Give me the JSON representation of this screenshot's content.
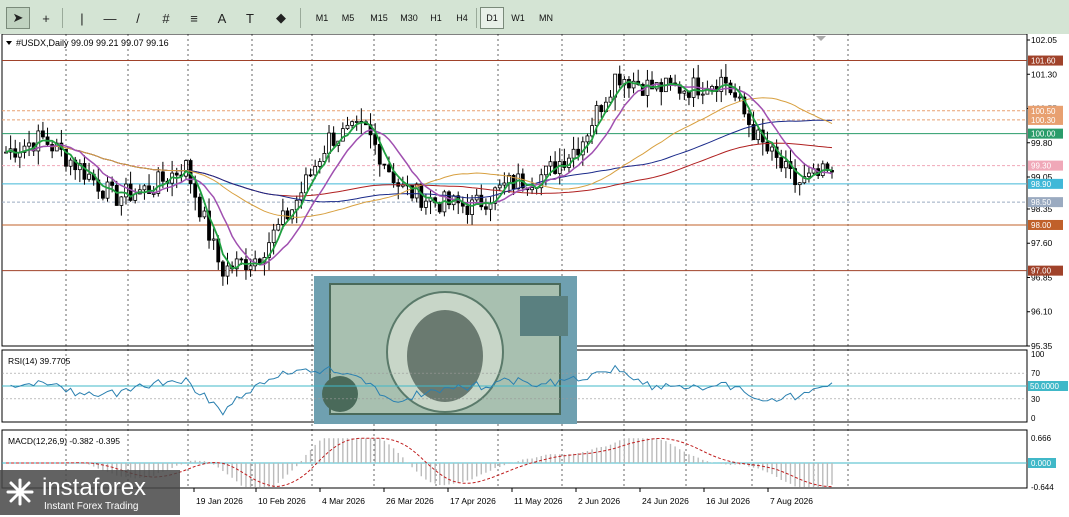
{
  "toolbar": {
    "timeframes": [
      "M1",
      "M5",
      "M15",
      "M30",
      "H1",
      "H4",
      "D1",
      "W1",
      "MN"
    ],
    "active_timeframe": "D1",
    "tools": [
      {
        "name": "cursor-icon",
        "glyph": "➤"
      },
      {
        "name": "crosshair-icon",
        "glyph": "+"
      },
      {
        "name": "vertical-line-icon",
        "glyph": "|"
      },
      {
        "name": "horizontal-line-icon",
        "glyph": "—"
      },
      {
        "name": "trendline-icon",
        "glyph": "/"
      },
      {
        "name": "channel-icon",
        "glyph": "#"
      },
      {
        "name": "fibonacci-icon",
        "glyph": "≡"
      },
      {
        "name": "text-icon",
        "glyph": "A"
      },
      {
        "name": "text-label-icon",
        "glyph": "T"
      },
      {
        "name": "shapes-icon",
        "glyph": "◆"
      }
    ]
  },
  "main_chart": {
    "header": "#USDX,Daily  99.09 99.21 99.07 99.16",
    "price_axis": [
      "102.05",
      "101.30",
      "100.55",
      "99.80",
      "99.05",
      "98.35",
      "97.60",
      "96.85",
      "96.10",
      "95.35"
    ],
    "level_lines": [
      {
        "label": "101.60",
        "color": "#a0422a"
      },
      {
        "label": "100.50",
        "color": "#e8a070"
      },
      {
        "label": "100.30",
        "color": "#e8a070"
      },
      {
        "label": "100.00",
        "color": "#2a9c6a"
      },
      {
        "label": "99.30",
        "color": "#f0a8b8"
      },
      {
        "label": "98.90",
        "color": "#40b8d8"
      },
      {
        "label": "98.50",
        "color": "#9aaac0"
      },
      {
        "label": "98.00",
        "color": "#c0602a"
      },
      {
        "label": "97.00",
        "color": "#a0422a"
      }
    ],
    "current_price": "99.16"
  },
  "chart_data": {
    "type": "line",
    "x": [
      "2025-12-10",
      "2025-12-20",
      "2025-12-31",
      "2026-01-10",
      "2026-01-19",
      "2026-01-28",
      "2026-02-10",
      "2026-02-20",
      "2026-03-04",
      "2026-03-15",
      "2026-03-26",
      "2026-04-05",
      "2026-04-17",
      "2026-04-28",
      "2026-05-11",
      "2026-05-22",
      "2026-06-02",
      "2026-06-13",
      "2026-06-24",
      "2026-07-05",
      "2026-07-16",
      "2026-07-27",
      "2026-08-07",
      "2026-08-18"
    ],
    "series": [
      {
        "name": "",
        "values": [
          99.6,
          99.9,
          99.3,
          98.6,
          98.8,
          99.3,
          97.0,
          97.3,
          98.4,
          99.9,
          100.1,
          98.8,
          98.5,
          98.4,
          98.9,
          99.1,
          99.8,
          101.3,
          101.0,
          101.0,
          101.2,
          99.8,
          98.9,
          99.16
        ]
      }
    ],
    "ylim": [
      95.35,
      102.05
    ]
  },
  "rsi": {
    "header": "RSI(14) 39.7705",
    "axis": [
      "100",
      "70",
      "50.0000",
      "30",
      "0"
    ]
  },
  "macd": {
    "header": "MACD(12,26,9) -0.382 -0.395",
    "axis": [
      "0.666",
      "0.000",
      "-0.644"
    ]
  },
  "date_axis": [
    "19 Jan 2026",
    "10 Feb 2026",
    "4 Mar 2026",
    "26 Mar 2026",
    "17 Apr 2026",
    "11 May 2026",
    "2 Jun 2026",
    "24 Jun 2026",
    "16 Jul 2026",
    "7 Aug 2026"
  ],
  "branding": {
    "logo": "instaforex",
    "tagline": "Instant Forex Trading"
  }
}
